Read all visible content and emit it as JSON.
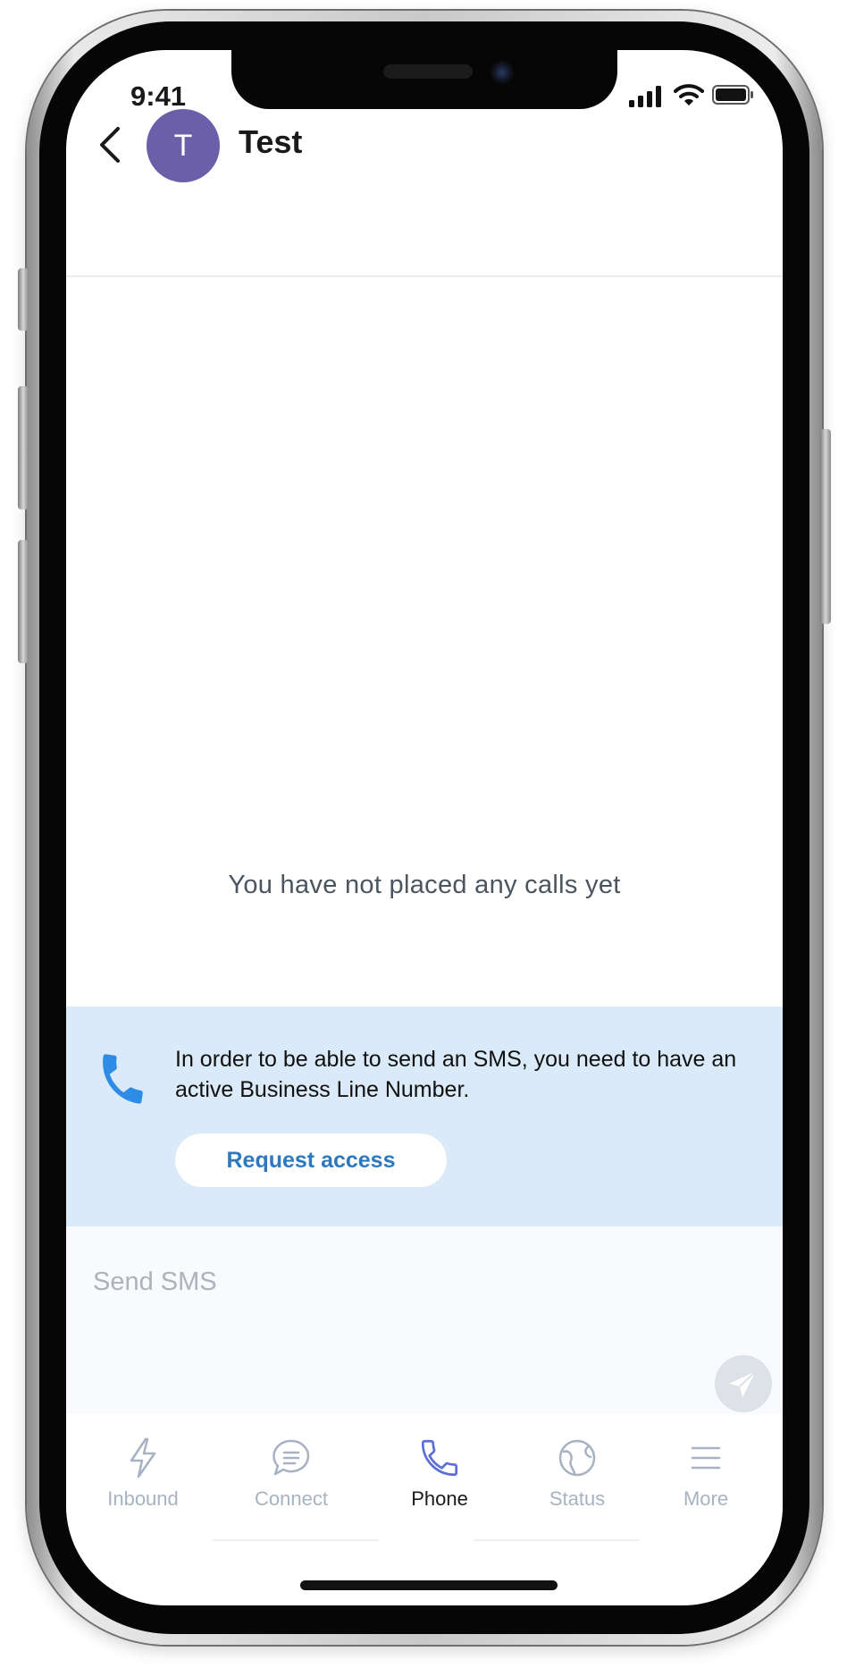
{
  "status_bar": {
    "time": "9:41"
  },
  "header": {
    "avatar_initial": "T",
    "contact_name": "Test"
  },
  "empty_state": {
    "message": "You have not placed any calls yet"
  },
  "sms_banner": {
    "message": "In order to be able to send an SMS, you need to have an active Business Line Number.",
    "button_label": "Request access"
  },
  "composer": {
    "placeholder": "Send SMS",
    "value": ""
  },
  "tabs": [
    {
      "label": "Inbound",
      "icon": "lightning-icon",
      "active": false
    },
    {
      "label": "Connect",
      "icon": "chat-bubble-icon",
      "active": false
    },
    {
      "label": "Phone",
      "icon": "phone-icon",
      "active": true
    },
    {
      "label": "Status",
      "icon": "globe-status-icon",
      "active": false
    },
    {
      "label": "More",
      "icon": "menu-icon",
      "active": false
    }
  ],
  "colors": {
    "avatar": "#6a5fa8",
    "banner_bg": "#dbeaf8",
    "accent_blue": "#2e78bd",
    "phone_icon_blue": "#2e8be6",
    "tab_inactive": "#a7b3c2",
    "active_phone_tab_icon": "#5b6fd6"
  }
}
